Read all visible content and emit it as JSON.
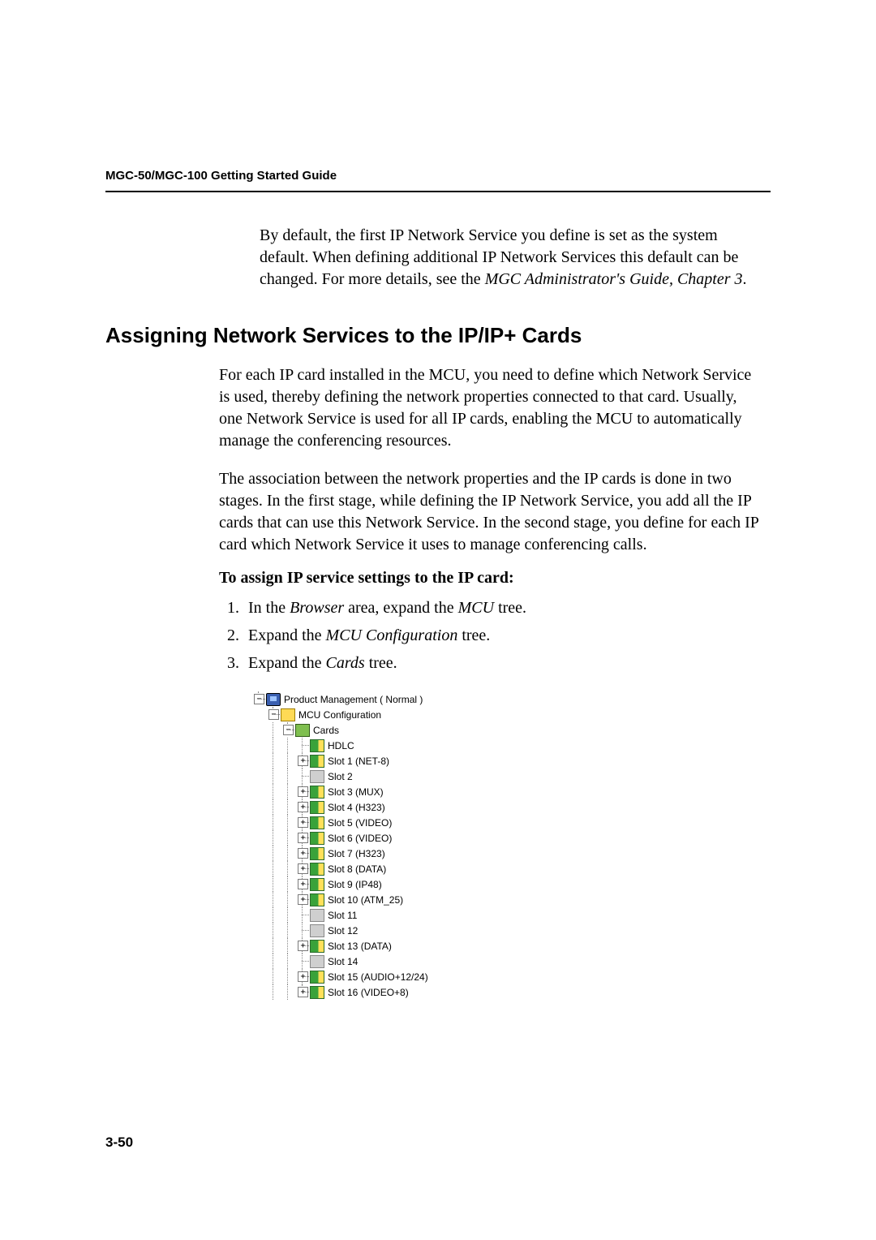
{
  "header": {
    "running_head": "MGC-50/MGC-100 Getting Started Guide"
  },
  "intro": {
    "text_a": "By default, the first IP Network Service you define is set as the system default. When defining additional IP Network Services this default can be changed. For more details, see the ",
    "text_b_italic": "MGC Administrator's Guide, Chapter 3",
    "text_c": "."
  },
  "section": {
    "heading": "Assigning Network Services to the IP/IP+ Cards",
    "para1": "For each IP card installed in the MCU, you need to define which Network Service is used, thereby defining the network properties connected to that card. Usually, one Network Service is used for all IP cards, enabling the MCU to automatically manage the conferencing resources.",
    "para2": "The association between the network properties and the IP cards is done in two stages. In the first stage, while defining the IP Network Service, you add all the IP cards that can use this Network Service. In the second stage, you define for each IP card which Network Service it uses to manage conferencing calls.",
    "subhead": "To assign IP service settings to the IP card:",
    "steps": [
      {
        "pre": "In the ",
        "em": "Browser",
        "post": " area, expand the ",
        "em2": "MCU",
        "post2": " tree."
      },
      {
        "pre": "Expand the ",
        "em": "MCU Configuration",
        "post": " tree."
      },
      {
        "pre": "Expand the ",
        "em": "Cards",
        "post": " tree."
      }
    ]
  },
  "tree": {
    "root": {
      "label": "Product Management  ( Normal )",
      "expander": "−",
      "icon": "monitor"
    },
    "config": {
      "label": "MCU Configuration",
      "expander": "−",
      "icon": "config"
    },
    "cards_node": {
      "label": "Cards",
      "expander": "−",
      "icon": "cards"
    },
    "items": [
      {
        "label": "HDLC",
        "icon": "green",
        "expander": ""
      },
      {
        "label": "Slot 1 (NET-8)",
        "icon": "green",
        "expander": "+"
      },
      {
        "label": "Slot 2",
        "icon": "grey",
        "expander": ""
      },
      {
        "label": "Slot 3 (MUX)",
        "icon": "green",
        "expander": "+"
      },
      {
        "label": "Slot 4 (H323)",
        "icon": "green",
        "expander": "+"
      },
      {
        "label": "Slot 5 (VIDEO)",
        "icon": "green",
        "expander": "+"
      },
      {
        "label": "Slot 6 (VIDEO)",
        "icon": "green",
        "expander": "+"
      },
      {
        "label": "Slot 7 (H323)",
        "icon": "green",
        "expander": "+"
      },
      {
        "label": "Slot 8 (DATA)",
        "icon": "green",
        "expander": "+"
      },
      {
        "label": "Slot 9 (IP48)",
        "icon": "green",
        "expander": "+"
      },
      {
        "label": "Slot 10 (ATM_25)",
        "icon": "green",
        "expander": "+"
      },
      {
        "label": "Slot 11",
        "icon": "grey",
        "expander": ""
      },
      {
        "label": "Slot 12",
        "icon": "grey",
        "expander": ""
      },
      {
        "label": "Slot 13 (DATA)",
        "icon": "green",
        "expander": "+"
      },
      {
        "label": "Slot 14",
        "icon": "grey",
        "expander": ""
      },
      {
        "label": "Slot 15 (AUDIO+12/24)",
        "icon": "green",
        "expander": "+"
      },
      {
        "label": "Slot 16 (VIDEO+8)",
        "icon": "green",
        "expander": "+"
      }
    ]
  },
  "footer": {
    "page_number": "3-50"
  }
}
